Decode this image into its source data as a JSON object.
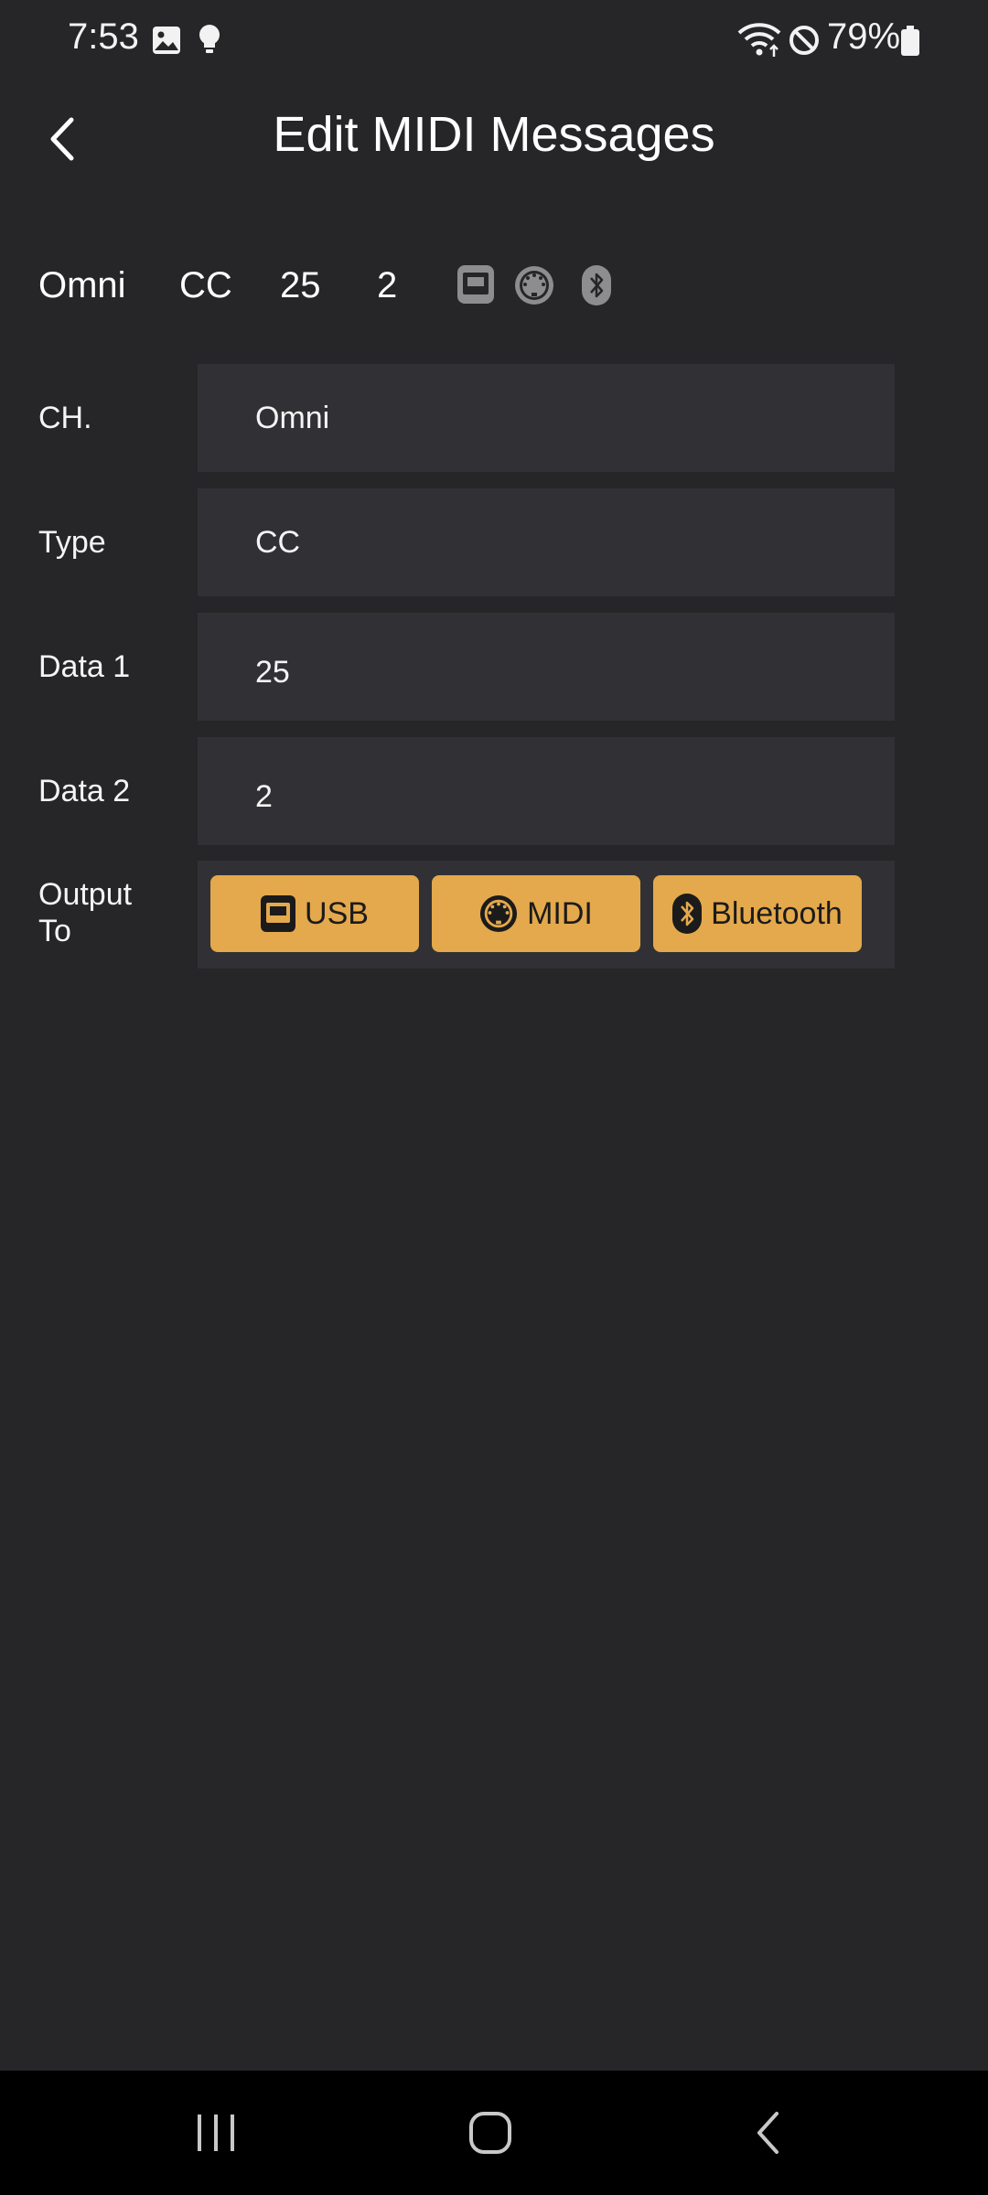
{
  "status_bar": {
    "time": "7:53",
    "battery": "79%",
    "icons": [
      "gallery-icon",
      "bulb-icon",
      "wifi-icon",
      "do-not-disturb-icon",
      "battery-icon"
    ]
  },
  "header": {
    "title": "Edit MIDI Messages",
    "back_icon": "chevron-left-icon"
  },
  "summary": {
    "channel": "Omni",
    "type": "CC",
    "data1": "25",
    "data2": "2",
    "icons": [
      "usb-icon",
      "midi-din-icon",
      "bluetooth-icon"
    ]
  },
  "form": {
    "channel": {
      "label": "CH.",
      "value": "Omni"
    },
    "type": {
      "label": "Type",
      "value": "CC"
    },
    "data1": {
      "label": "Data 1",
      "value": "25"
    },
    "data2": {
      "label": "Data 2",
      "value": "2"
    },
    "output": {
      "label_line1": "Output",
      "label_line2": "To",
      "buttons": [
        {
          "label": "USB",
          "icon": "usb-icon"
        },
        {
          "label": "MIDI",
          "icon": "midi-din-icon"
        },
        {
          "label": "Bluetooth",
          "icon": "bluetooth-icon"
        }
      ]
    }
  },
  "nav_bar": {
    "icons": [
      "recents-icon",
      "home-icon",
      "back-icon"
    ]
  },
  "colors": {
    "background": "#262628",
    "field_background": "#313135",
    "accent": "#e4a94c",
    "nav_background": "#000000"
  }
}
